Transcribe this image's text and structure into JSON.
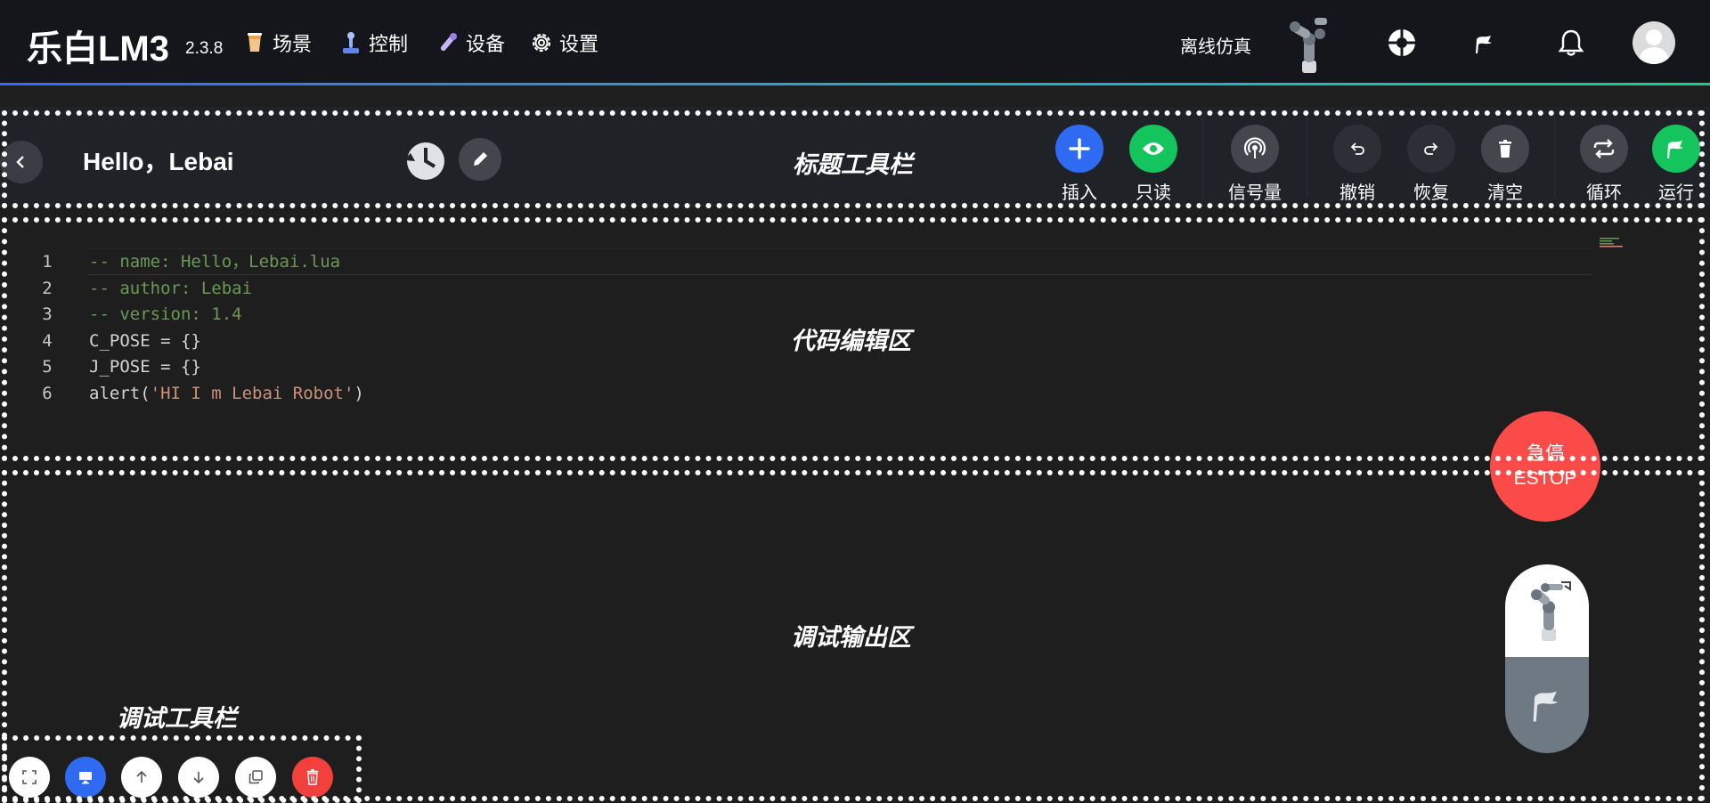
{
  "app": {
    "name": "乐白LM3",
    "version": "2.3.8"
  },
  "nav": [
    {
      "label": "场景",
      "icon": "cup-icon"
    },
    {
      "label": "控制",
      "icon": "joystick-icon"
    },
    {
      "label": "设备",
      "icon": "wand-icon"
    },
    {
      "label": "设置",
      "icon": "gear-icon"
    }
  ],
  "header_right": {
    "mode_label": "离线仿真"
  },
  "title_toolbar": {
    "script_title": "Hello，Lebai",
    "tools": [
      {
        "label": "插入",
        "icon": "plus-icon",
        "color": "#2f6bf2"
      },
      {
        "label": "只读",
        "icon": "eye-icon",
        "color": "#14c45d"
      },
      {
        "label": "信号量",
        "icon": "signal-icon",
        "color": "#43474d"
      },
      {
        "label": "撤销",
        "icon": "undo-icon",
        "color": "#2c3036"
      },
      {
        "label": "恢复",
        "icon": "redo-icon",
        "color": "#2c3036"
      },
      {
        "label": "清空",
        "icon": "trash-icon",
        "color": "#43474d"
      },
      {
        "label": "循环",
        "icon": "loop-icon",
        "color": "#43474d"
      },
      {
        "label": "运行",
        "icon": "flag-icon",
        "color": "#14c45d"
      }
    ]
  },
  "region_labels": {
    "title_toolbar": "标题工具栏",
    "code_editor": "代码编辑区",
    "debug_output": "调试输出区",
    "debug_toolbar": "调试工具栏"
  },
  "editor": {
    "lines": [
      {
        "num": "1",
        "segments": [
          {
            "text": "-- name: Hello，Lebai.lua",
            "kind": "comment"
          }
        ]
      },
      {
        "num": "2",
        "segments": [
          {
            "text": "-- author: Lebai",
            "kind": "comment"
          }
        ]
      },
      {
        "num": "3",
        "segments": [
          {
            "text": "-- version: 1.4",
            "kind": "comment"
          }
        ]
      },
      {
        "num": "4",
        "segments": [
          {
            "text": "C_POSE = {}",
            "kind": "plain"
          }
        ]
      },
      {
        "num": "5",
        "segments": [
          {
            "text": "J_POSE = {}",
            "kind": "plain"
          }
        ]
      },
      {
        "num": "6",
        "segments": [
          {
            "text": "alert(",
            "kind": "plain"
          },
          {
            "text": "'HI I m Lebai Robot'",
            "kind": "string"
          },
          {
            "text": ")",
            "kind": "plain"
          }
        ]
      }
    ]
  },
  "estop": {
    "line1": "急停",
    "line2": "ESTOP",
    "color": "#fb4b48"
  },
  "debug_toolbar": {
    "buttons": [
      {
        "icon": "fullscreen-icon",
        "color": "#ffffff"
      },
      {
        "icon": "monitor-icon",
        "color": "#2f6bf2"
      },
      {
        "icon": "arrow-up-icon",
        "color": "#ffffff"
      },
      {
        "icon": "arrow-down-icon",
        "color": "#ffffff"
      },
      {
        "icon": "copy-icon",
        "color": "#ffffff"
      },
      {
        "icon": "trash-icon",
        "color": "#f2413d"
      }
    ]
  }
}
